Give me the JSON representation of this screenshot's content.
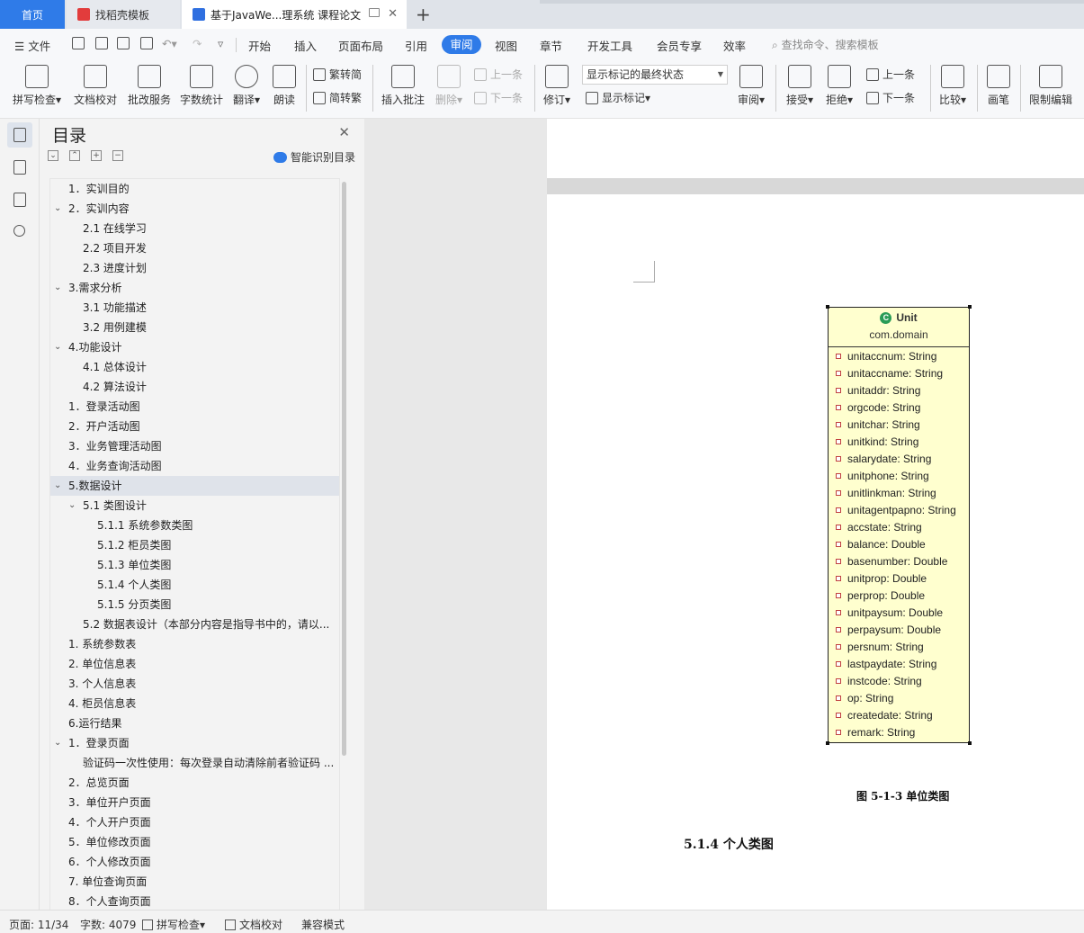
{
  "tabs": {
    "home": "首页",
    "template": "找稻壳模板",
    "document": "基于JavaWe...理系统 课程论文"
  },
  "menu": {
    "file": "文件",
    "items": [
      "开始",
      "插入",
      "页面布局",
      "引用",
      "审阅",
      "视图",
      "章节",
      "开发工具",
      "会员专享",
      "效率"
    ],
    "active": "审阅",
    "search_placeholder": "查找命令、搜索模板"
  },
  "ribbon": {
    "spell_check": "拼写检查",
    "doc_proof": "文档校对",
    "review_service": "批改服务",
    "word_count": "字数统计",
    "translate": "翻译",
    "read_aloud": "朗读",
    "trad_to_simp_a": "繁转简",
    "simp_to_trad": "简转繁",
    "insert_comment": "插入批注",
    "delete": "删除",
    "prev_comment": "上一条",
    "next_comment": "下一条",
    "revise": "修订",
    "markup_state": "显示标记的最终状态",
    "show_markup": "显示标记",
    "review": "审阅",
    "accept": "接受",
    "reject": "拒绝",
    "prev_change": "上一条",
    "next_change": "下一条",
    "compare": "比较",
    "pen": "画笔",
    "restrict_edit": "限制编辑"
  },
  "toc": {
    "title": "目录",
    "smart_label": "智能识别目录",
    "items": [
      {
        "text": "1．实训目的",
        "level": 1,
        "chev": false
      },
      {
        "text": "2．实训内容",
        "level": 1,
        "chev": true
      },
      {
        "text": "2.1  在线学习",
        "level": 2,
        "chev": false
      },
      {
        "text": "2.2  项目开发",
        "level": 2,
        "chev": false
      },
      {
        "text": "2.3  进度计划",
        "level": 2,
        "chev": false
      },
      {
        "text": "3.需求分析",
        "level": 1,
        "chev": true
      },
      {
        "text": "3.1  功能描述",
        "level": 2,
        "chev": false
      },
      {
        "text": "3.2  用例建模",
        "level": 2,
        "chev": false
      },
      {
        "text": "4.功能设计",
        "level": 1,
        "chev": true
      },
      {
        "text": "4.1  总体设计",
        "level": 2,
        "chev": false
      },
      {
        "text": "4.2  算法设计",
        "level": 2,
        "chev": false
      },
      {
        "text": "1．登录活动图",
        "level": 1,
        "chev": false
      },
      {
        "text": "2．开户活动图",
        "level": 1,
        "chev": false
      },
      {
        "text": "3．业务管理活动图",
        "level": 1,
        "chev": false
      },
      {
        "text": "4．业务查询活动图",
        "level": 1,
        "chev": false
      },
      {
        "text": "5.数据设计",
        "level": 1,
        "chev": true,
        "selected": true
      },
      {
        "text": "5.1  类图设计",
        "level": 2,
        "chev": true
      },
      {
        "text": "5.1.1  系统参数类图",
        "level": 3,
        "chev": false
      },
      {
        "text": "5.1.2  柜员类图",
        "level": 3,
        "chev": false
      },
      {
        "text": "5.1.3  单位类图",
        "level": 3,
        "chev": false
      },
      {
        "text": "5.1.4  个人类图",
        "level": 3,
        "chev": false
      },
      {
        "text": "5.1.5  分页类图",
        "level": 3,
        "chev": false
      },
      {
        "text": "5.2  数据表设计（本部分内容是指导书中的，请以...",
        "level": 2,
        "chev": false
      },
      {
        "text": "1. 系统参数表",
        "level": 1,
        "chev": false
      },
      {
        "text": "2. 单位信息表",
        "level": 1,
        "chev": false
      },
      {
        "text": "3. 个人信息表",
        "level": 1,
        "chev": false
      },
      {
        "text": "4. 柜员信息表",
        "level": 1,
        "chev": false
      },
      {
        "text": "6.运行结果",
        "level": 1,
        "chev": false
      },
      {
        "text": "1．登录页面",
        "level": 1,
        "chev": true
      },
      {
        "text": "验证码一次性使用：每次登录自动清除前者验证码 ...",
        "level": 2,
        "chev": false
      },
      {
        "text": "2．总览页面",
        "level": 1,
        "chev": false
      },
      {
        "text": "3．单位开户页面",
        "level": 1,
        "chev": false
      },
      {
        "text": "4．个人开户页面",
        "level": 1,
        "chev": false
      },
      {
        "text": "5．单位修改页面",
        "level": 1,
        "chev": false
      },
      {
        "text": "6．个人修改页面",
        "level": 1,
        "chev": false
      },
      {
        "text": "7. 单位查询页面",
        "level": 1,
        "chev": false
      },
      {
        "text": "8．个人查询页面",
        "level": 1,
        "chev": false
      }
    ]
  },
  "uml": {
    "class_name": "Unit",
    "package": "com.domain",
    "attributes": [
      "unitaccnum: String",
      "unitaccname: String",
      "unitaddr: String",
      "orgcode: String",
      "unitchar: String",
      "unitkind: String",
      "salarydate: String",
      "unitphone: String",
      "unitlinkman: String",
      "unitagentpapno: String",
      "accstate: String",
      "balance: Double",
      "basenumber: Double",
      "unitprop: Double",
      "perprop: Double",
      "unitpaysum: Double",
      "perpaysum: Double",
      "persnum: String",
      "lastpaydate: String",
      "instcode: String",
      "op: String",
      "createdate: String",
      "remark: String"
    ]
  },
  "document": {
    "caption": "图 5-1-3  单位类图",
    "heading": "5.1.4  个人类图"
  },
  "status": {
    "page": "页面: 11/34",
    "words": "字数: 4079",
    "spell": "拼写检查",
    "proof": "文档校对",
    "compat": "兼容模式"
  },
  "colors": {
    "accent": "#2f7be8",
    "uml_fill": "#ffffcf"
  }
}
